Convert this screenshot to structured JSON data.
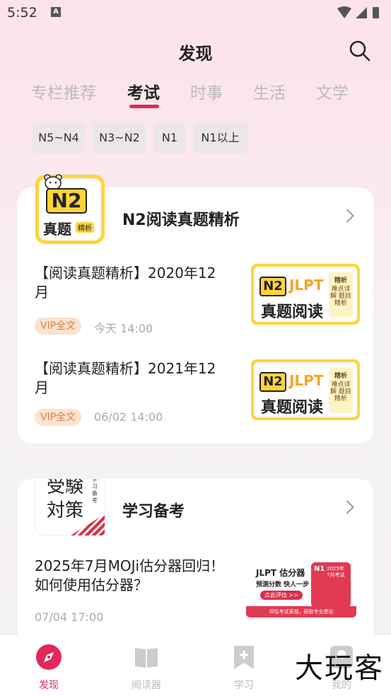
{
  "status_bar": {
    "time": "5:52",
    "a_badge": "A"
  },
  "header": {
    "title": "发现"
  },
  "tabs": [
    {
      "label": "专栏推荐",
      "active": false
    },
    {
      "label": "考试",
      "active": true
    },
    {
      "label": "时事",
      "active": false
    },
    {
      "label": "生活",
      "active": false
    },
    {
      "label": "文学",
      "active": false
    }
  ],
  "filters": [
    "N5~N4",
    "N3~N2",
    "N1",
    "N1以上"
  ],
  "section1": {
    "title": "N2阅读真题精析",
    "logo_big": "N2",
    "logo_sub": "真题",
    "logo_tag": "精析",
    "articles": [
      {
        "title": "【阅读真题精析】2020年12月",
        "badge": "VIP全文",
        "time": "今天 14:00",
        "thumb": {
          "n2": "N2",
          "jlpt": "JLPT",
          "main": "真题阅读",
          "side_top": "精析",
          "side_body": "难点详解 题目精析"
        }
      },
      {
        "title": "【阅读真题精析】2021年12月",
        "badge": "VIP全文",
        "time": "06/02 14:00",
        "thumb": {
          "n2": "N2",
          "jlpt": "JLPT",
          "main": "真题阅读",
          "side_top": "精析",
          "side_body": "难点详解 题目精析"
        }
      }
    ]
  },
  "section2": {
    "title": "学习备考",
    "logo_line1": "受験",
    "logo_line2": "対策",
    "logo_side": "学习备考",
    "article": {
      "title": "2025年7月MOJi估分器回归！如何使用估分器？",
      "time": "07/04 17:00",
      "thumb": {
        "head": "JLPT 估分器",
        "sub": "预测分数 快人一步",
        "cta": "点此评估 >>",
        "badge": "N1",
        "card_year": "2025年",
        "card_month": "7月考试",
        "footer": "评估考试表现，获取专业建议"
      }
    }
  },
  "bottom_nav": [
    {
      "label": "发现",
      "icon": "compass-icon",
      "active": true
    },
    {
      "label": "阅读器",
      "icon": "book-icon",
      "active": false
    },
    {
      "label": "学习",
      "icon": "bookmark-plus-icon",
      "active": false
    },
    {
      "label": "我的",
      "icon": "user-icon",
      "active": false
    }
  ],
  "watermark": "大玩客",
  "colors": {
    "accent": "#e2285a",
    "logo_yellow": "#ffd43a",
    "vip_bg": "#fbe2d1",
    "vip_text": "#d98343"
  }
}
